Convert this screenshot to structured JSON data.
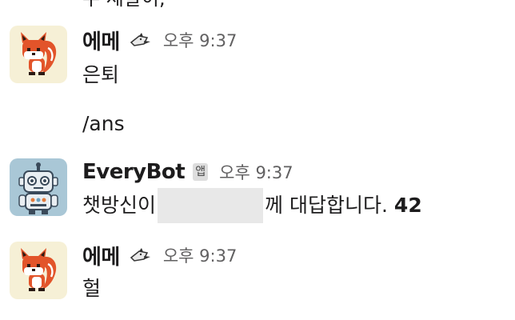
{
  "top_cutoff_text": "수 세살이,",
  "messages": [
    {
      "sender": "에메",
      "time": "오후 9:37",
      "status_icon": "thinking-bird-emoji",
      "lines": [
        "은퇴",
        "/ans"
      ]
    },
    {
      "sender": "EveryBot",
      "badge": "앱",
      "time": "오후 9:37",
      "text_before": "챗방신이",
      "text_after": "께 대답합니다.",
      "answer": "42"
    },
    {
      "sender": "에메",
      "time": "오후 9:37",
      "status_icon": "thinking-bird-emoji",
      "lines": [
        "헐"
      ]
    }
  ],
  "colors": {
    "time": "#616061",
    "badge_bg": "#dddddd",
    "redaction": "#e8e8e8",
    "fox": "#e2542a",
    "bot_bg": "#a9c7d6"
  }
}
